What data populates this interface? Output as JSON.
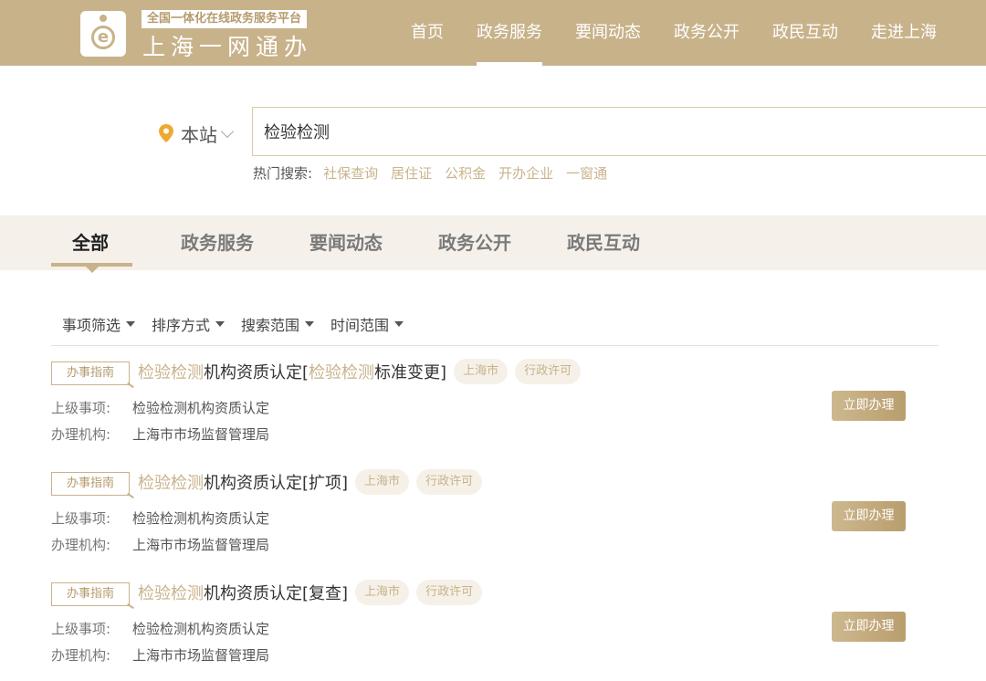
{
  "header": {
    "logo_tag": "全国一体化在线政务服务平台",
    "logo_name": "上海一网通办",
    "nav": [
      "首页",
      "政务服务",
      "要闻动态",
      "政务公开",
      "政民互动",
      "走进上海"
    ],
    "active_nav": "政务服务"
  },
  "search": {
    "location": "本站",
    "query": "检验检测",
    "hot_label": "热门搜索:",
    "hot_links": [
      "社保查询",
      "居住证",
      "公积金",
      "开办企业",
      "一窗通"
    ]
  },
  "tabs": {
    "items": [
      "全部",
      "政务服务",
      "要闻动态",
      "政务公开",
      "政民互动"
    ],
    "active": "全部"
  },
  "filters": [
    "事项筛选",
    "排序方式",
    "搜索范围",
    "时间范围"
  ],
  "results": [
    {
      "tag": "办事指南",
      "title_parts": [
        {
          "text": "检验检测",
          "hl": true
        },
        {
          "text": "机构资质认定[",
          "hl": false
        },
        {
          "text": "检验检测",
          "hl": true
        },
        {
          "text": "标准变更]",
          "hl": false
        }
      ],
      "pills": [
        "上海市",
        "行政许可"
      ],
      "parent_label": "上级事项:",
      "parent_value": "检验检测机构资质认定",
      "org_label": "办理机构:",
      "org_value": "上海市市场监督管理局",
      "button": "立即办理"
    },
    {
      "tag": "办事指南",
      "title_parts": [
        {
          "text": "检验检测",
          "hl": true
        },
        {
          "text": "机构资质认定[扩项]",
          "hl": false
        }
      ],
      "pills": [
        "上海市",
        "行政许可"
      ],
      "parent_label": "上级事项:",
      "parent_value": "检验检测机构资质认定",
      "org_label": "办理机构:",
      "org_value": "上海市市场监督管理局",
      "button": "立即办理"
    },
    {
      "tag": "办事指南",
      "title_parts": [
        {
          "text": "检验检测",
          "hl": true
        },
        {
          "text": "机构资质认定[复查]",
          "hl": false
        }
      ],
      "pills": [
        "上海市",
        "行政许可"
      ],
      "parent_label": "上级事项:",
      "parent_value": "检验检测机构资质认定",
      "org_label": "办理机构:",
      "org_value": "上海市市场监督管理局",
      "button": "立即办理"
    }
  ],
  "colors": {
    "brand": "#c8b28a",
    "highlight": "#c8b28a",
    "pin": "#f0a830"
  }
}
